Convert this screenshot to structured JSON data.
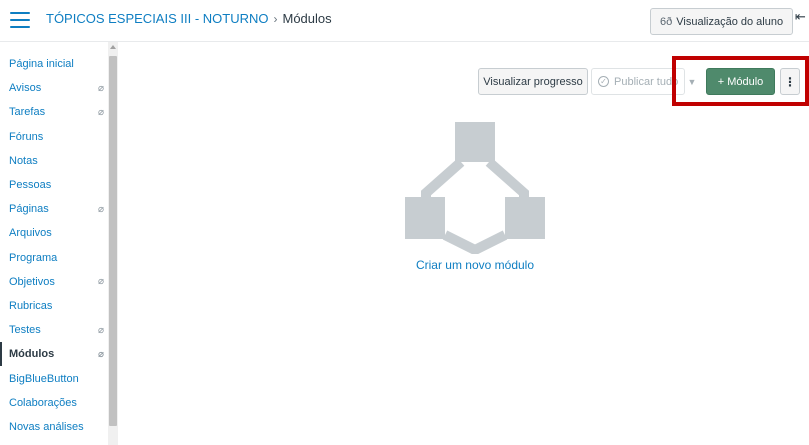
{
  "header": {
    "course_name": "TÓPICOS ESPECIAIS III - NOTURNO",
    "separator": "›",
    "current_page": "Módulos",
    "student_view_label": "Visualização do aluno",
    "student_view_icon": "glasses-icon",
    "collapse_icon": "⇤"
  },
  "sidebar": {
    "items": [
      {
        "label": "Página inicial",
        "hidden": false,
        "active": false
      },
      {
        "label": "Avisos",
        "hidden": true,
        "active": false
      },
      {
        "label": "Tarefas",
        "hidden": true,
        "active": false
      },
      {
        "label": "Fóruns",
        "hidden": false,
        "active": false
      },
      {
        "label": "Notas",
        "hidden": false,
        "active": false
      },
      {
        "label": "Pessoas",
        "hidden": false,
        "active": false
      },
      {
        "label": "Páginas",
        "hidden": true,
        "active": false
      },
      {
        "label": "Arquivos",
        "hidden": false,
        "active": false
      },
      {
        "label": "Programa",
        "hidden": false,
        "active": false
      },
      {
        "label": "Objetivos",
        "hidden": true,
        "active": false
      },
      {
        "label": "Rubricas",
        "hidden": false,
        "active": false
      },
      {
        "label": "Testes",
        "hidden": true,
        "active": false
      },
      {
        "label": "Módulos",
        "hidden": true,
        "active": true
      },
      {
        "label": "BigBlueButton",
        "hidden": false,
        "active": false
      },
      {
        "label": "Colaborações",
        "hidden": false,
        "active": false
      },
      {
        "label": "Novas análises",
        "hidden": false,
        "active": false
      }
    ]
  },
  "toolbar": {
    "progress_label": "Visualizar progresso",
    "publish_label": "Publicar tudo",
    "module_label": "+ Módulo",
    "kebab_label": "⋮"
  },
  "empty_state": {
    "create_label": "Criar um novo módulo"
  },
  "colors": {
    "link": "#0e7ec2",
    "primary_button": "#4f8a6c",
    "highlight": "#c00000",
    "illustration": "#c7cdd1"
  }
}
